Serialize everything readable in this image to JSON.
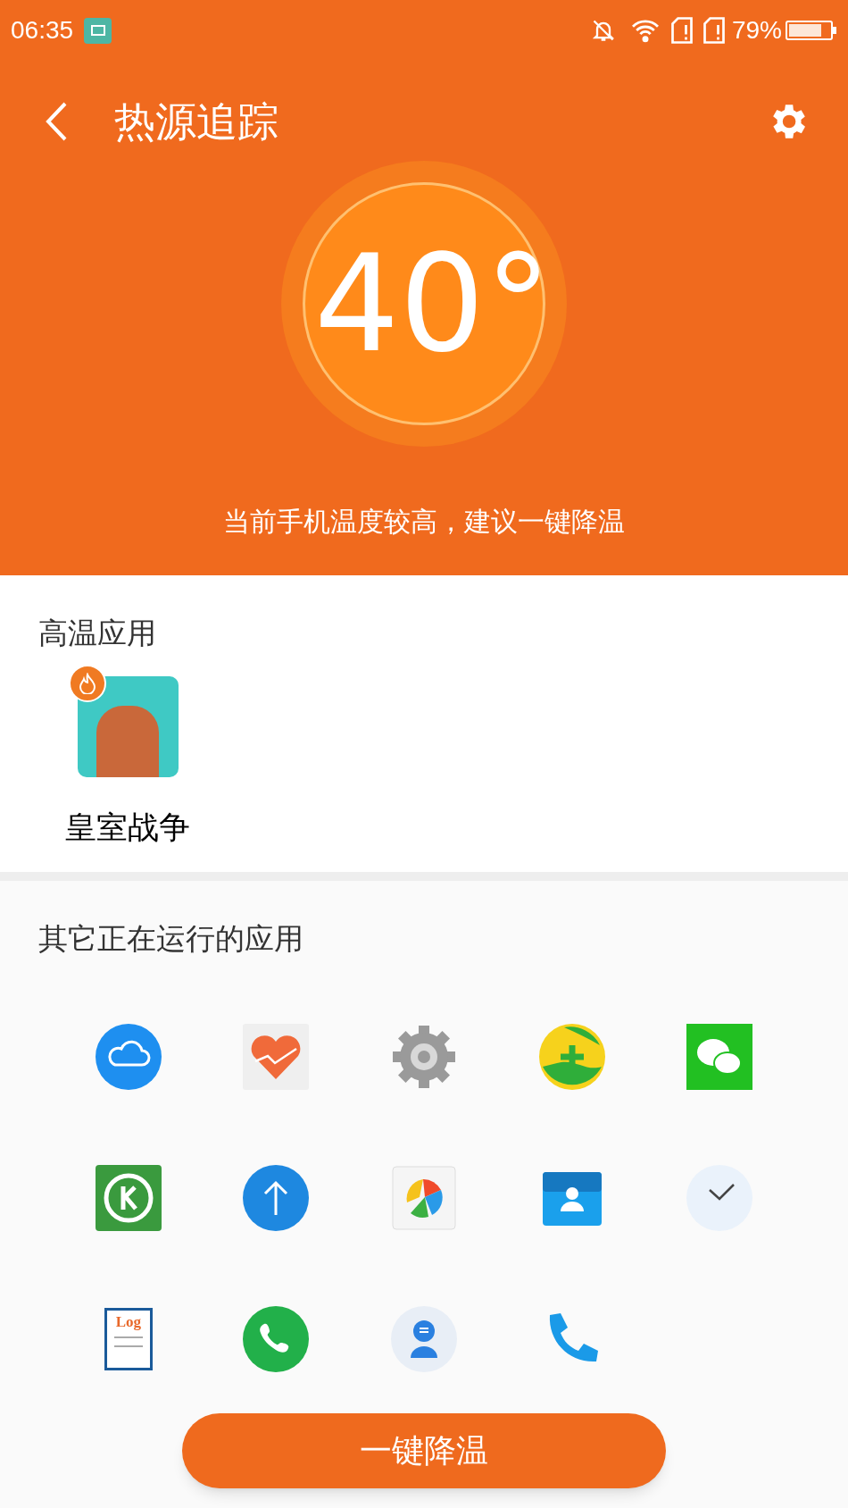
{
  "status_bar": {
    "time": "06:35",
    "battery": "79%"
  },
  "header": {
    "title": "热源追踪",
    "temperature": "40°",
    "advice": "当前手机温度较高，建议一键降温"
  },
  "hot_apps": {
    "title": "高温应用",
    "apps": [
      {
        "name": "皇室战争"
      }
    ]
  },
  "running_apps": {
    "title": "其它正在运行的应用",
    "apps": [
      {
        "kind": "cloud"
      },
      {
        "kind": "health"
      },
      {
        "kind": "settings"
      },
      {
        "kind": "security"
      },
      {
        "kind": "chat"
      },
      {
        "kind": "music"
      },
      {
        "kind": "upload"
      },
      {
        "kind": "ball"
      },
      {
        "kind": "contacts"
      },
      {
        "kind": "clock"
      },
      {
        "kind": "log",
        "label": "Log"
      },
      {
        "kind": "call"
      },
      {
        "kind": "assistant"
      },
      {
        "kind": "dialer"
      }
    ]
  },
  "action_button": "一键降温"
}
